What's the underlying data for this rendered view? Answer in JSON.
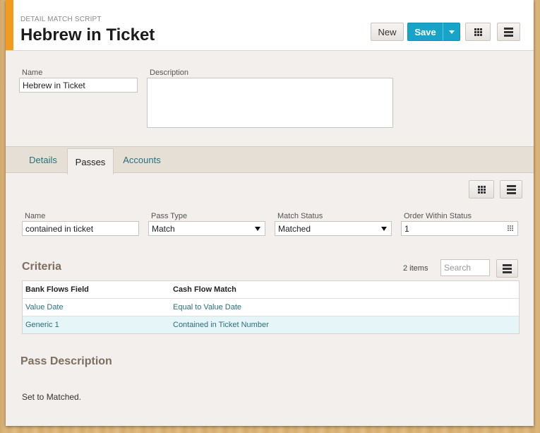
{
  "header": {
    "eyebrow": "DETAIL MATCH SCRIPT",
    "title": "Hebrew in Ticket",
    "new_label": "New",
    "save_label": "Save"
  },
  "form": {
    "name_label": "Name",
    "name_value": "Hebrew in Ticket",
    "description_label": "Description",
    "description_value": ""
  },
  "tabs": [
    {
      "label": "Details",
      "active": false
    },
    {
      "label": "Passes",
      "active": true
    },
    {
      "label": "Accounts",
      "active": false
    }
  ],
  "pass": {
    "name_label": "Name",
    "name_value": "contained in ticket",
    "pass_type_label": "Pass Type",
    "pass_type_value": "Match",
    "match_status_label": "Match Status",
    "match_status_value": "Matched",
    "order_label": "Order Within Status",
    "order_value": "1"
  },
  "criteria": {
    "title": "Criteria",
    "count": "2 items",
    "search_placeholder": "Search",
    "columns": [
      "Bank Flows Field",
      "Cash Flow Match"
    ],
    "rows": [
      {
        "field": "Value Date",
        "match": "Equal to Value Date",
        "selected": false
      },
      {
        "field": "Generic 1",
        "match": "Contained in Ticket Number",
        "selected": true
      }
    ]
  },
  "pass_description": {
    "title": "Pass Description",
    "text": "Set to Matched."
  },
  "icons": {
    "grid": "grid-icon",
    "menu": "menu-icon",
    "dropdown": "chevron-down-icon",
    "keypad": "keypad-icon"
  },
  "colors": {
    "accent": "#f29b1d",
    "primary": "#18a3c8",
    "link": "#2a6f7a",
    "selected_row": "#e5f5f8"
  }
}
